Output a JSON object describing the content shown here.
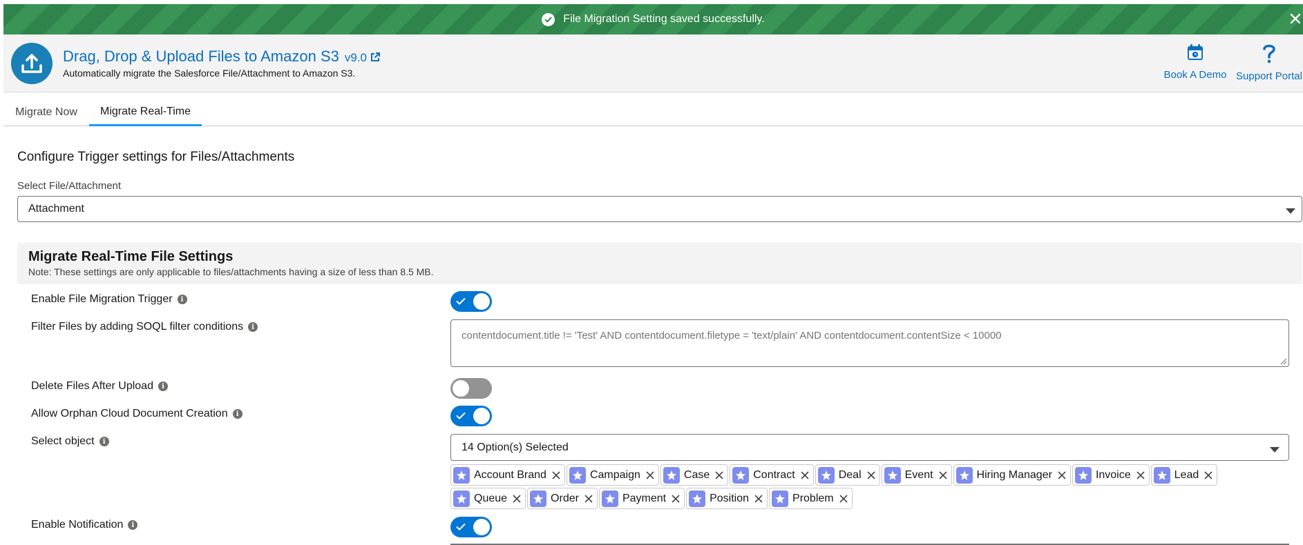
{
  "toast": {
    "message": "File Migration Setting saved successfully."
  },
  "header": {
    "title": "Drag, Drop & Upload Files to Amazon S3",
    "version": "v9.0",
    "subtitle": "Automatically migrate the Salesforce File/Attachment to Amazon S3.",
    "actions": [
      {
        "label": "Book A Demo",
        "icon": "calendar-icon"
      },
      {
        "label": "Support Portal",
        "icon": "question-icon"
      }
    ]
  },
  "tabs": [
    {
      "label": "Migrate Now",
      "active": false
    },
    {
      "label": "Migrate Real-Time",
      "active": true
    }
  ],
  "main": {
    "heading": "Configure Trigger settings for Files/Attachments",
    "select_label": "Select File/Attachment",
    "select_value": "Attachment"
  },
  "settings": {
    "title": "Migrate Real-Time File Settings",
    "note": "Note: These settings are only applicable to files/attachments having a size of less than 8.5 MB.",
    "enable_trigger": {
      "label": "Enable File Migration Trigger",
      "enabled": true
    },
    "filter": {
      "label": "Filter Files by adding SOQL filter conditions",
      "placeholder": "contentdocument.title != 'Test' AND contentdocument.filetype = 'text/plain' AND contentdocument.contentSize < 10000"
    },
    "delete_after": {
      "label": "Delete Files After Upload",
      "enabled": false
    },
    "allow_orphan": {
      "label": "Allow Orphan Cloud Document Creation",
      "enabled": true
    },
    "select_object": {
      "label": "Select object",
      "summary": "14 Option(s) Selected",
      "options": [
        "Account Brand",
        "Campaign",
        "Case",
        "Contract",
        "Deal",
        "Event",
        "Hiring Manager",
        "Invoice",
        "Lead",
        "Queue",
        "Order",
        "Payment",
        "Position",
        "Problem"
      ]
    },
    "enable_notification": {
      "label": "Enable Notification",
      "enabled": true
    }
  },
  "colors": {
    "toast_green": "#2e844a",
    "brand_blue": "#0176d3",
    "link_blue": "#0b6fbd",
    "pill_icon": "#7f8ced"
  }
}
